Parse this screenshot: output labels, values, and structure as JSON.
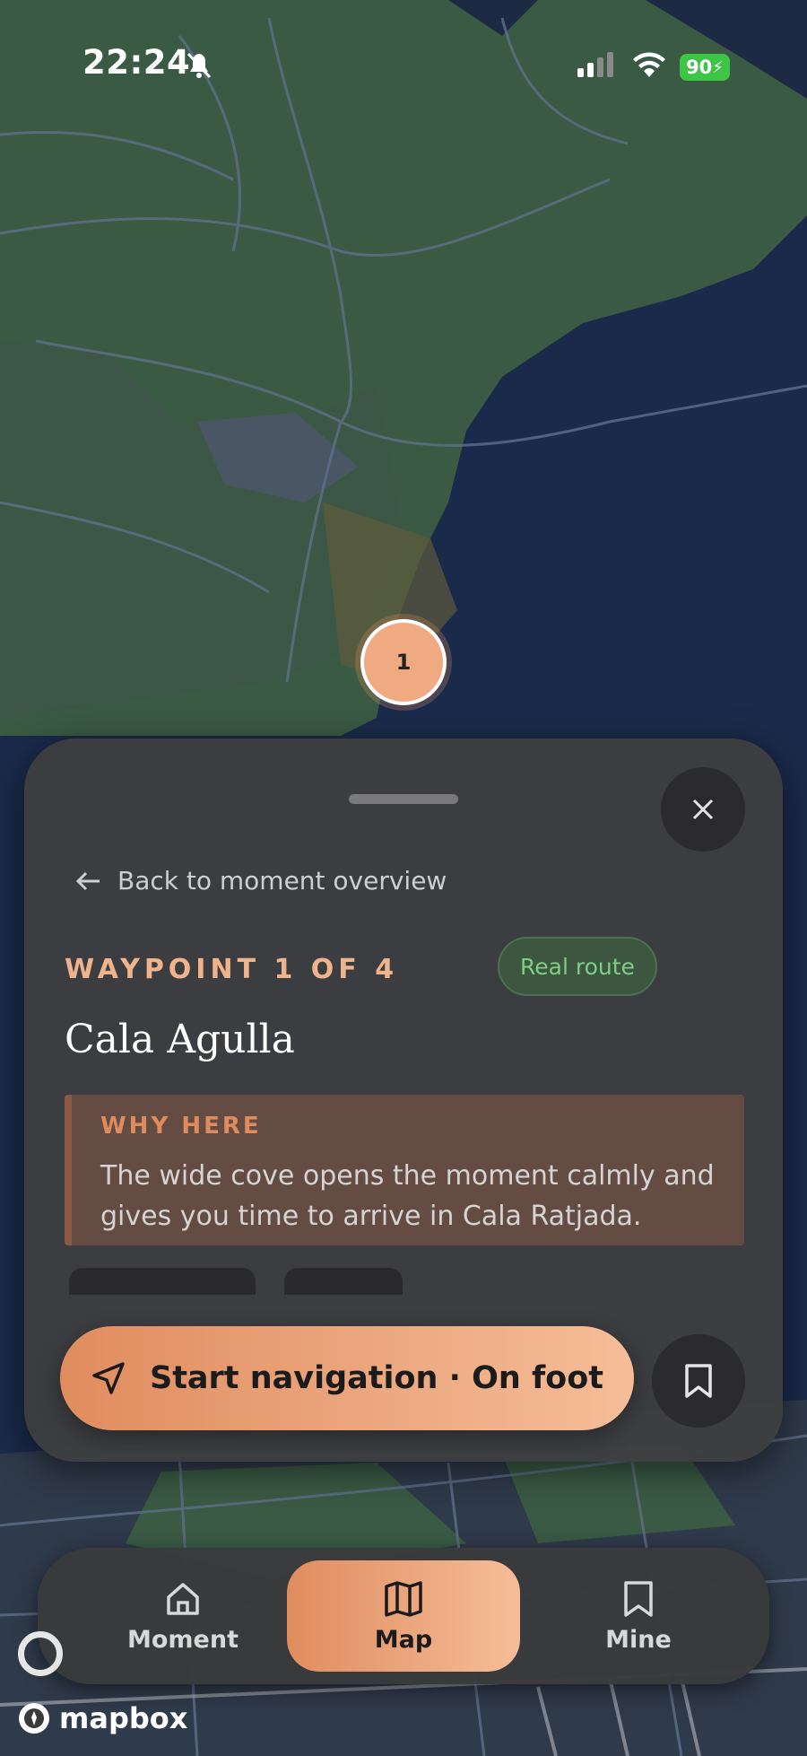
{
  "status_bar": {
    "time": "22:24",
    "battery": "90"
  },
  "map": {
    "marker_label": "1",
    "attribution": "mapbox"
  },
  "sheet": {
    "back_label": "Back to moment overview",
    "eyebrow": "WAYPOINT 1 OF 4",
    "badge": "Real route",
    "title": "Cala Agulla",
    "why_label": "WHY HERE",
    "why_text": "The wide cove opens the moment calmly and gives you time to arrive in Cala Ratjada.",
    "primary_action": "Start navigation · On foot"
  },
  "tabs": [
    {
      "label": "Moment",
      "icon": "home-icon"
    },
    {
      "label": "Map",
      "icon": "map-icon",
      "active": true
    },
    {
      "label": "Mine",
      "icon": "bookmark-icon"
    }
  ],
  "colors": {
    "accent_start": "#e08c5f",
    "accent_end": "#f6bd98",
    "badge_text": "#7fce86"
  }
}
